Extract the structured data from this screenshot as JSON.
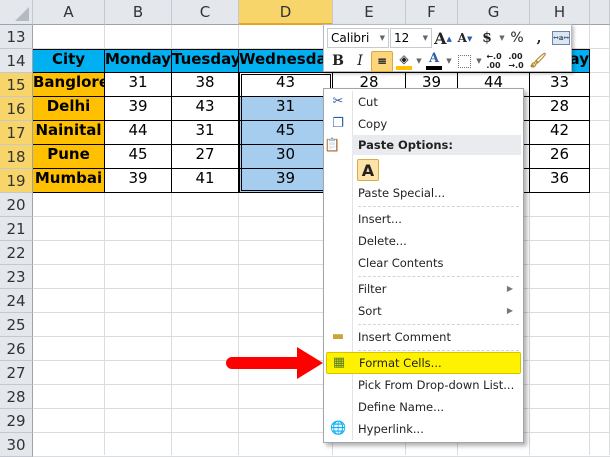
{
  "columns": [
    "A",
    "B",
    "C",
    "D",
    "E",
    "F",
    "G",
    "H"
  ],
  "selected_column": "D",
  "rows": [
    "13",
    "14",
    "15",
    "16",
    "17",
    "18",
    "19",
    "20",
    "21",
    "22",
    "23",
    "24",
    "25",
    "26",
    "27",
    "28",
    "29",
    "30"
  ],
  "table": {
    "headers": [
      "City",
      "Monday",
      "Tuesday",
      "Wednesday",
      "",
      "",
      "",
      "ay"
    ],
    "data": [
      [
        "Banglore",
        "31",
        "38",
        "43",
        "28",
        "39",
        "44",
        "33"
      ],
      [
        "Delhi",
        "39",
        "43",
        "31",
        "",
        "",
        "",
        "28"
      ],
      [
        "Nainital",
        "44",
        "31",
        "45",
        "",
        "",
        "",
        "42"
      ],
      [
        "Pune",
        "45",
        "27",
        "30",
        "",
        "",
        "",
        "26"
      ],
      [
        "Mumbai",
        "39",
        "41",
        "39",
        "",
        "",
        "",
        "36"
      ]
    ]
  },
  "mini_toolbar": {
    "font": "Calibri",
    "size": "12",
    "currency": "$",
    "percent": "%",
    "comma": ","
  },
  "context_menu": {
    "items": [
      {
        "label": "Cut",
        "icon": "scissors-icon"
      },
      {
        "label": "Copy",
        "icon": "copy-icon"
      },
      {
        "label": "Paste Options:",
        "icon": "paste-icon"
      },
      {
        "label": "A",
        "icon": "paste-keep-text"
      },
      {
        "label": "Paste Special..."
      },
      {
        "label": "Insert..."
      },
      {
        "label": "Delete..."
      },
      {
        "label": "Clear Contents"
      },
      {
        "label": "Filter",
        "submenu": true
      },
      {
        "label": "Sort",
        "submenu": true
      },
      {
        "label": "Insert Comment",
        "icon": "comment-icon"
      },
      {
        "label": "Format Cells...",
        "icon": "format-cells-icon",
        "highlighted": true
      },
      {
        "label": "Pick From Drop-down List..."
      },
      {
        "label": "Define Name..."
      },
      {
        "label": "Hyperlink...",
        "icon": "hyperlink-icon"
      }
    ]
  },
  "colors": {
    "header_fill": "#00b0f0",
    "city_fill": "#ffc000",
    "selection": "#a6cdee",
    "highlight": "#fff200",
    "arrow": "#ff0000"
  }
}
